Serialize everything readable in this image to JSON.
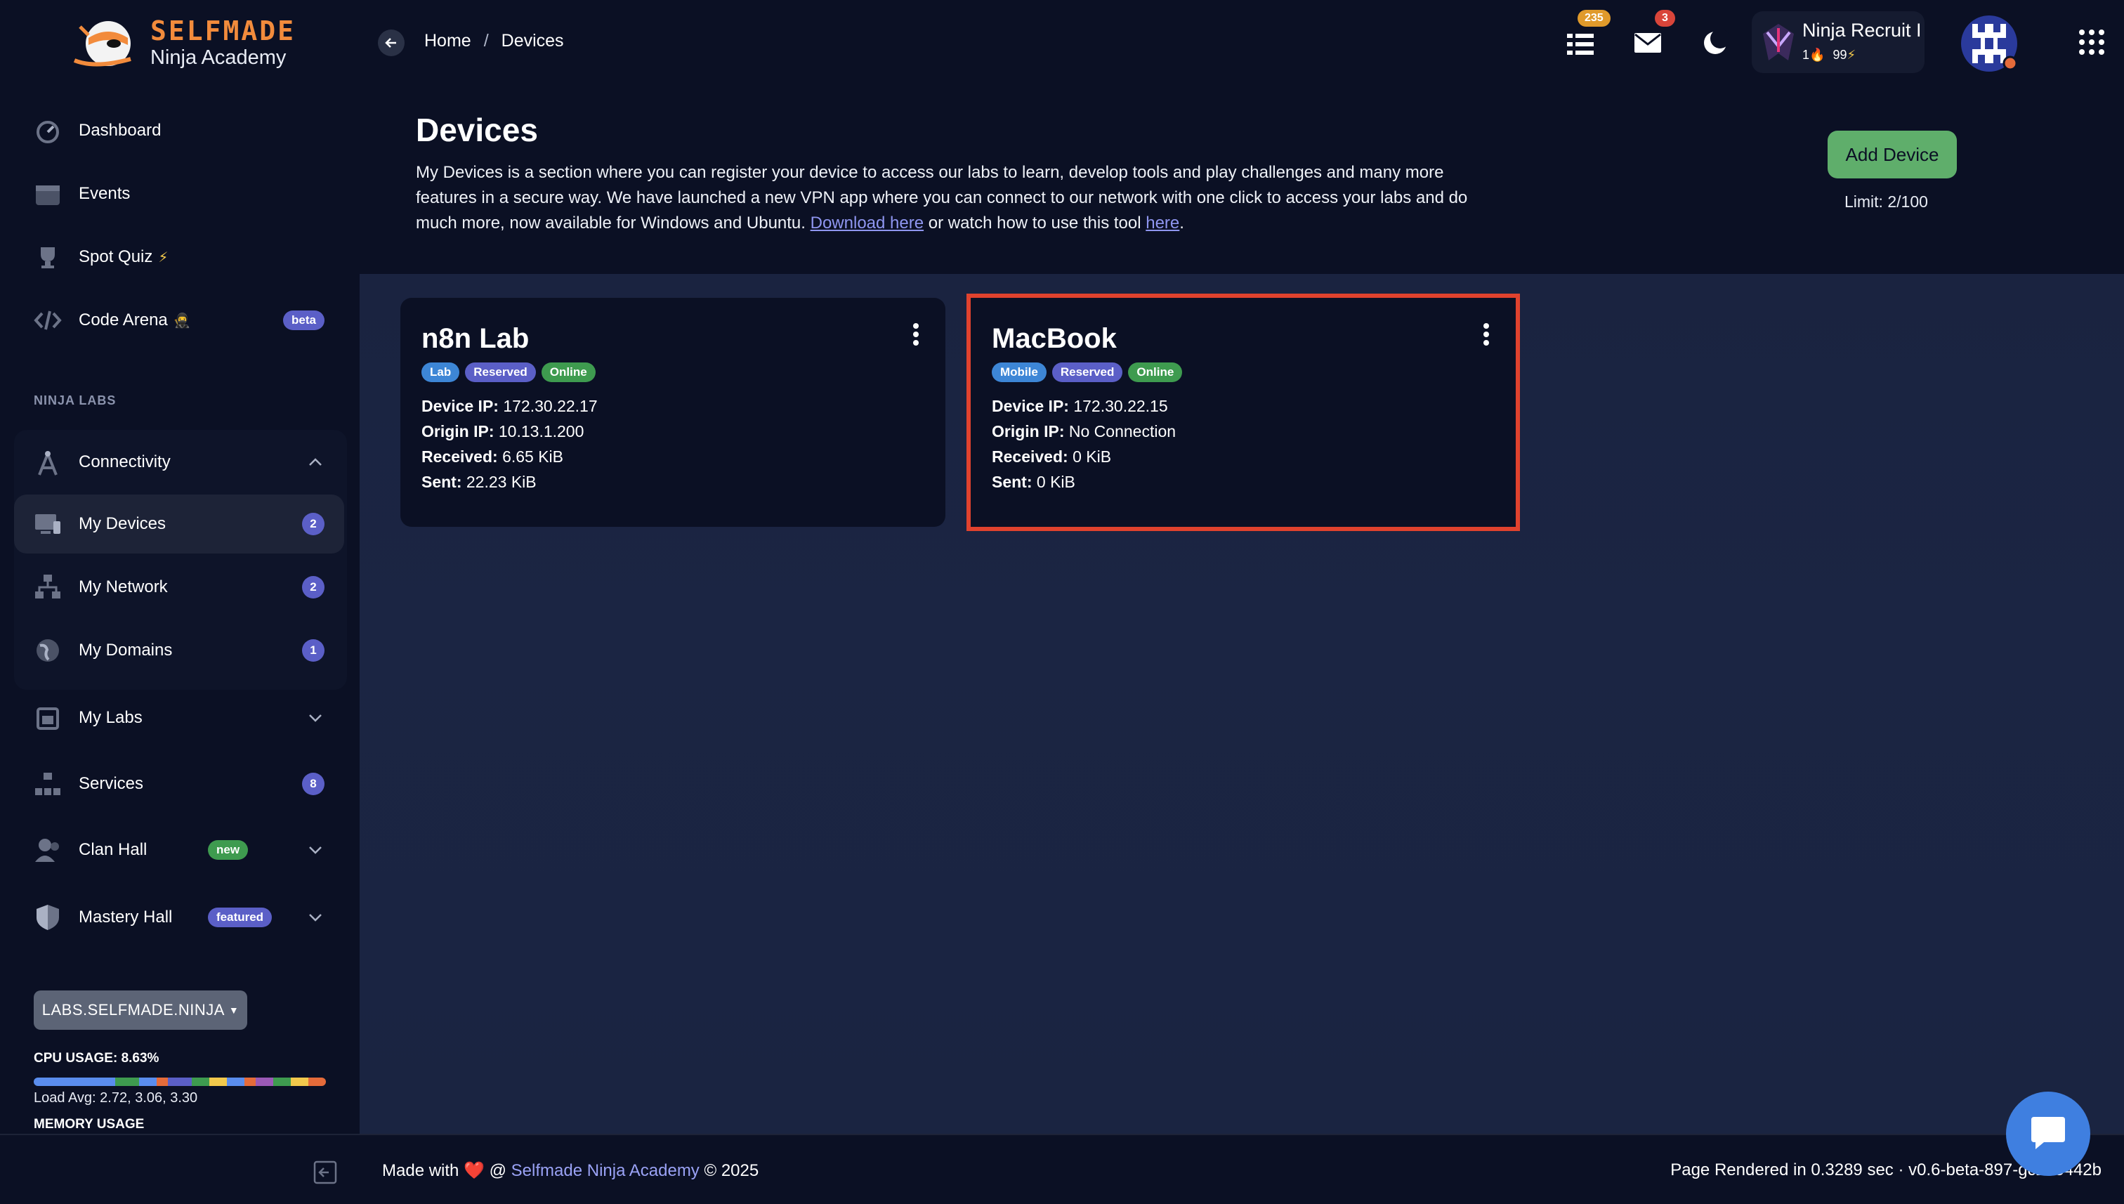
{
  "brand": {
    "name": "SELFMADE",
    "subtitle": "Ninja Academy"
  },
  "breadcrumb": {
    "home": "Home",
    "separator": "/",
    "current": "Devices"
  },
  "header": {
    "notifications_count": "235",
    "messages_count": "3",
    "user": {
      "name": "Ninja Recruit I",
      "streak": "1",
      "points": "99"
    }
  },
  "sidebar": {
    "top_items": [
      {
        "label": "Dashboard"
      },
      {
        "label": "Events"
      },
      {
        "label": "Spot Quiz",
        "suffix": "⚡"
      },
      {
        "label": "Code Arena",
        "suffix": "🥷",
        "tag": "beta"
      }
    ],
    "section_label": "NINJA LABS",
    "connectivity": {
      "label": "Connectivity"
    },
    "sub_items": [
      {
        "label": "My Devices",
        "count": "2"
      },
      {
        "label": "My Network",
        "count": "2"
      },
      {
        "label": "My Domains",
        "count": "1"
      }
    ],
    "bottom_items": [
      {
        "label": "My Labs"
      },
      {
        "label": "Services",
        "count": "8"
      },
      {
        "label": "Clan Hall",
        "tag": "new"
      },
      {
        "label": "Mastery Hall",
        "tag": "featured"
      }
    ],
    "lab_selector": "LABS.SELFMADE.NINJA",
    "cpu_usage": "CPU USAGE: 8.63%",
    "load_avg": "Load Avg: 2.72, 3.06, 3.30",
    "memory_usage": "MEMORY USAGE"
  },
  "page": {
    "title": "Devices",
    "desc_part1": "My Devices is a section where you can register your device to access our labs to learn, develop tools and play challenges and many more features in a secure way. We have launched a new VPN app where you can connect to our network with one click to access your labs and do much more, now available for Windows and Ubuntu.",
    "download_link": "Download here",
    "desc_part2": "or watch how to use this tool",
    "here_link": "here",
    "desc_end": ".",
    "add_button": "Add Device",
    "limit": "Limit: 2/100"
  },
  "devices": [
    {
      "name": "n8n Lab",
      "tags": [
        "Lab",
        "Reserved",
        "Online"
      ],
      "device_ip_label": "Device IP:",
      "device_ip": "172.30.22.17",
      "origin_ip_label": "Origin IP:",
      "origin_ip": "10.13.1.200",
      "received_label": "Received:",
      "received": "6.65 KiB",
      "sent_label": "Sent:",
      "sent": "22.23 KiB"
    },
    {
      "name": "MacBook",
      "tags": [
        "Mobile",
        "Reserved",
        "Online"
      ],
      "device_ip_label": "Device IP:",
      "device_ip": "172.30.22.15",
      "origin_ip_label": "Origin IP:",
      "origin_ip": "No Connection",
      "received_label": "Received:",
      "received": "0 KiB",
      "sent_label": "Sent:",
      "sent": "0 KiB"
    }
  ],
  "footer": {
    "made_with": "Made with",
    "heart": "❤️",
    "at": "@",
    "org": "Selfmade Ninja Academy",
    "year": "© 2025",
    "rendered": "Page Rendered in 0.3289 sec · v0.6-beta-897-gc2b5442b"
  },
  "colors": {
    "accent": "#5b5fc7",
    "tag_lab": "#3d86d6",
    "tag_reserved": "#5b5fc7",
    "tag_online": "#3e9b4f",
    "tag_new": "#3e9b4f",
    "highlight": "#e0422e",
    "add_button": "#5fae6b"
  },
  "icons": {
    "dashboard": "gauge-icon",
    "events": "calendar-icon",
    "spot_quiz": "trophy-icon",
    "code_arena": "code-icon",
    "connectivity": "antenna-icon",
    "devices": "monitor-icon",
    "network": "network-icon",
    "domains": "globe-icon",
    "labs": "flask-icon",
    "services": "sitemap-icon",
    "clan": "users-icon",
    "mastery": "shield-icon"
  }
}
